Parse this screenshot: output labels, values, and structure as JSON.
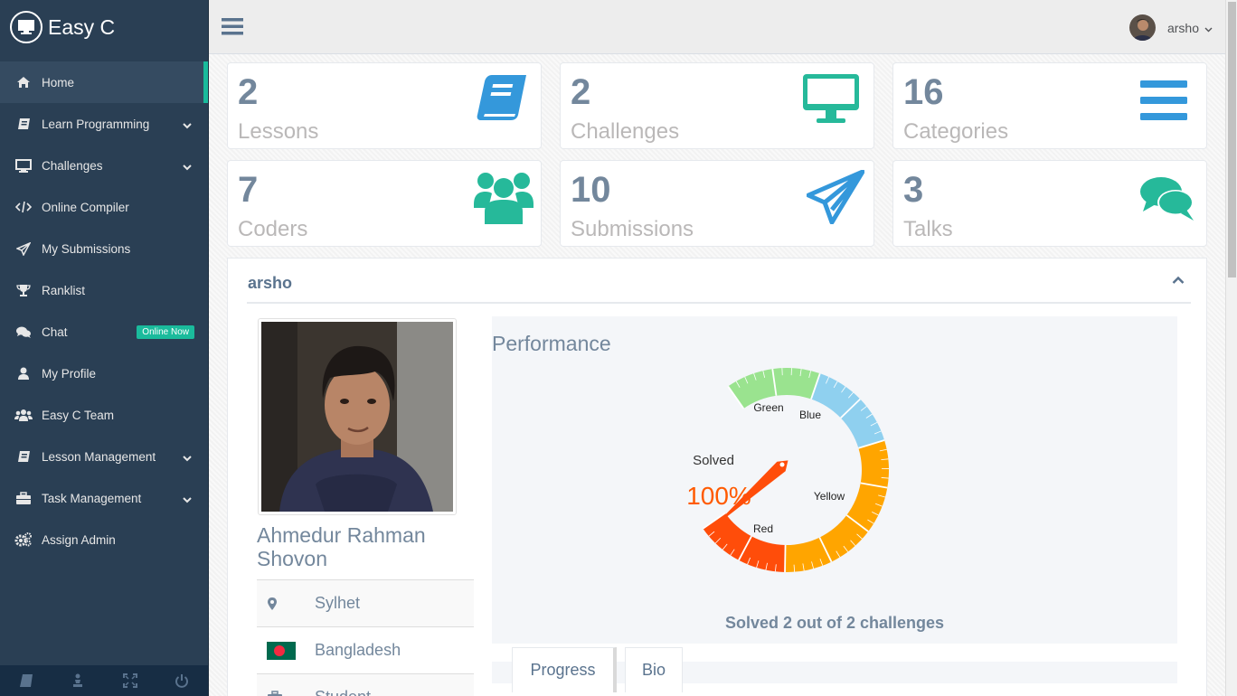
{
  "app": {
    "name": "Easy C"
  },
  "sidebar": {
    "items": [
      {
        "label": "Home",
        "icon": "home-icon",
        "active": true
      },
      {
        "label": "Learn Programming",
        "icon": "book-icon",
        "has_submenu": true
      },
      {
        "label": "Challenges",
        "icon": "desktop-icon",
        "has_submenu": true
      },
      {
        "label": "Online Compiler",
        "icon": "code-icon"
      },
      {
        "label": "My Submissions",
        "icon": "paper-plane-icon"
      },
      {
        "label": "Ranklist",
        "icon": "trophy-icon"
      },
      {
        "label": "Chat",
        "icon": "comments-icon",
        "badge": "Online Now"
      },
      {
        "label": "My Profile",
        "icon": "user-icon"
      },
      {
        "label": "Easy C Team",
        "icon": "users-icon"
      },
      {
        "label": "Lesson Management",
        "icon": "book-icon",
        "has_submenu": true
      },
      {
        "label": "Task Management",
        "icon": "briefcase-icon",
        "has_submenu": true
      },
      {
        "label": "Assign Admin",
        "icon": "gears-icon"
      }
    ],
    "footer_icons": [
      "book-icon",
      "chess-icon",
      "fullscreen-icon",
      "power-icon"
    ]
  },
  "topnav": {
    "username": "arsho"
  },
  "tiles": [
    {
      "count": "2",
      "label": "Lessons",
      "icon": "book-icon",
      "color": "#3498db"
    },
    {
      "count": "2",
      "label": "Challenges",
      "icon": "desktop-icon",
      "color": "#26b99a"
    },
    {
      "count": "16",
      "label": "Categories",
      "icon": "bars-icon",
      "color": "#3498db"
    },
    {
      "count": "7",
      "label": "Coders",
      "icon": "users-icon",
      "color": "#26b99a"
    },
    {
      "count": "10",
      "label": "Submissions",
      "icon": "paper-plane-icon",
      "color": "#3498db"
    },
    {
      "count": "3",
      "label": "Talks",
      "icon": "comments-icon",
      "color": "#26b99a"
    }
  ],
  "profile": {
    "panel_title": "arsho",
    "name": "Ahmedur Rahman Shovon",
    "location": "Sylhet",
    "country": "Bangladesh",
    "role": "Student"
  },
  "performance": {
    "title": "Performance",
    "gauge_label": "Solved",
    "gauge_value": "100%",
    "percent": 100,
    "zones": [
      "Green",
      "Blue",
      "Yellow",
      "Red"
    ],
    "summary": "Solved 2 out of 2 challenges"
  },
  "tabs": [
    {
      "label": "Progress",
      "active": true
    },
    {
      "label": "Bio",
      "active": false
    }
  ],
  "colors": {
    "accent": "#1abb9c",
    "sidebar": "#2a3f54",
    "text": "#73879c"
  }
}
